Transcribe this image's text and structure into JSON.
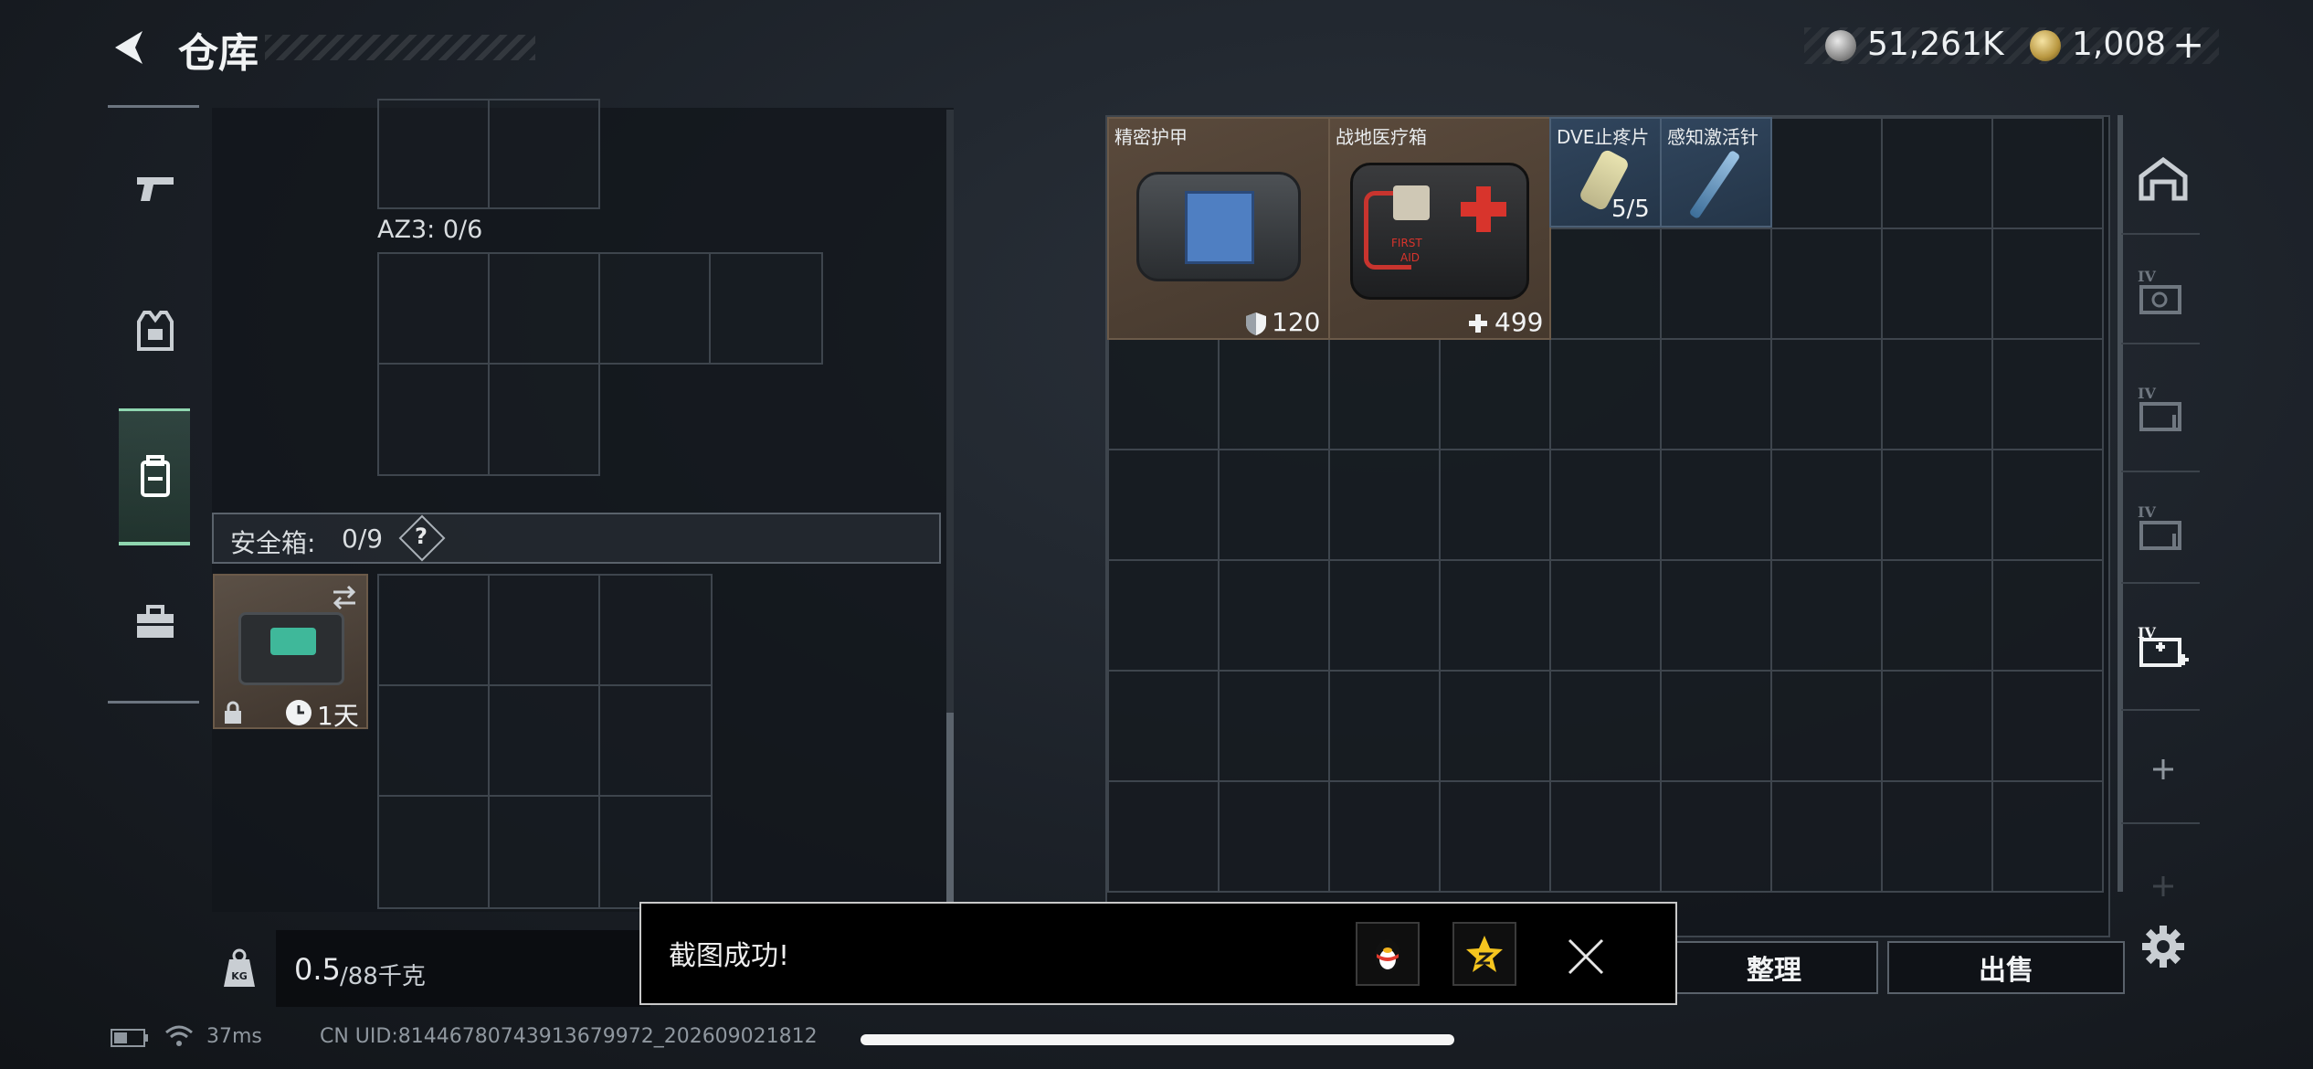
{
  "header": {
    "title": "仓库",
    "currency_coins": "51,261K",
    "currency_premium": "1,008",
    "currency_add": "+"
  },
  "nav": {
    "items": [
      {
        "name": "weapons",
        "icon": "pistol-icon"
      },
      {
        "name": "gear",
        "icon": "vest-icon"
      },
      {
        "name": "backpack",
        "icon": "backpack-icon",
        "active": true
      },
      {
        "name": "toolbox",
        "icon": "toolbox-icon"
      }
    ]
  },
  "left_panel": {
    "az3_label": "AZ3: 0/6",
    "safe_box_label": "安全箱:",
    "safe_box_count": "0/9",
    "safe_box_help": "?",
    "safe_box_timer": "1天",
    "weight_value": "0.5",
    "weight_max": "/88千克"
  },
  "stash": {
    "items": [
      {
        "name": "精密护甲",
        "value": "120",
        "badge_icon": "shield-icon"
      },
      {
        "name": "战地医疗箱",
        "value": "499",
        "badge_icon": "plus-icon",
        "sticker_line1": "FIRST",
        "sticker_line2": "AID"
      },
      {
        "name": "DVE止疼片",
        "count": "5/5"
      },
      {
        "name": "感知激活针"
      }
    ]
  },
  "buttons": {
    "sort": "整理",
    "sell": "出售"
  },
  "right_rail": {
    "icons": [
      "warehouse-icon",
      "stash-tab-2-icon",
      "stash-tab-3-icon",
      "stash-tab-4-icon",
      "stash-tab-add-icon",
      "add-tab-icon",
      "add-tab-faint-icon",
      "settings-icon"
    ],
    "tier_label": "IV"
  },
  "toast": {
    "message": "截图成功!"
  },
  "footer": {
    "ping": "37ms",
    "uid": "CN UID:81446780743913679972_202609021812"
  },
  "colors": {
    "accent_green": "#8fd6b0",
    "tile_brown": "#4e4034",
    "tile_blue": "#2b3e53"
  }
}
